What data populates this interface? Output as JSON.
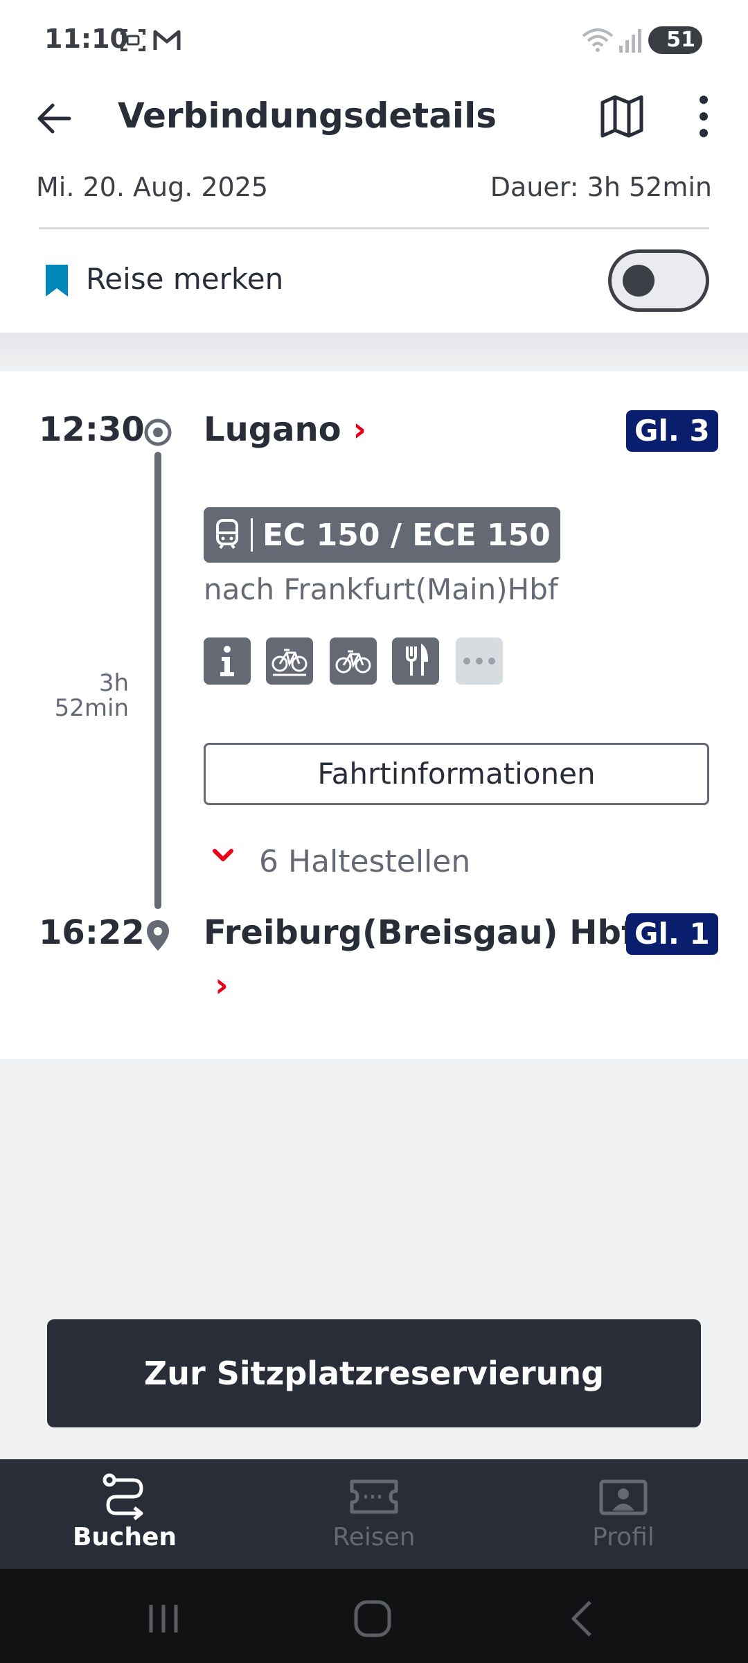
{
  "status_bar": {
    "time": "11:10",
    "battery": "51",
    "icons": [
      "screenshot-icon",
      "gmail-icon",
      "wifi-icon",
      "signal-icon",
      "battery-icon"
    ]
  },
  "header": {
    "title": "Verbindungsdetails",
    "date": "Mi. 20. Aug. 2025",
    "duration": "Dauer: 3h 52min",
    "save_trip_label": "Reise merken",
    "save_trip_enabled": false
  },
  "journey": {
    "departure": {
      "time": "12:30",
      "station": "Lugano",
      "chevron": "›",
      "platform": "Gl. 3"
    },
    "arrival": {
      "time": "16:22",
      "station": "Freiburg(Breisgau) Hbf",
      "chevron": "›",
      "platform": "Gl. 1"
    },
    "duration_hours": "3h",
    "duration_minutes": "52min",
    "train": {
      "name": "EC 150 / ECE 150",
      "direction": "nach Frankfurt(Main)Hbf"
    },
    "amenities": [
      "info-icon",
      "bike-reservation-icon",
      "bike-icon",
      "restaurant-icon",
      "more-icon"
    ],
    "trip_info_button": "Fahrtinformationen",
    "stops_label": "6 Haltestellen"
  },
  "cta": {
    "label": "Zur Sitzplatzreservierung"
  },
  "bottom_nav": {
    "items": [
      {
        "label": "Buchen",
        "icon": "route-icon",
        "active": true
      },
      {
        "label": "Reisen",
        "icon": "ticket-icon",
        "active": false
      },
      {
        "label": "Profil",
        "icon": "profile-icon",
        "active": false
      }
    ]
  },
  "colors": {
    "primary_dark": "#282d37",
    "accent_red": "#ec0016",
    "platform_blue": "#0a1e6e",
    "bookmark_blue": "#0087b9",
    "gray": "#646973"
  }
}
